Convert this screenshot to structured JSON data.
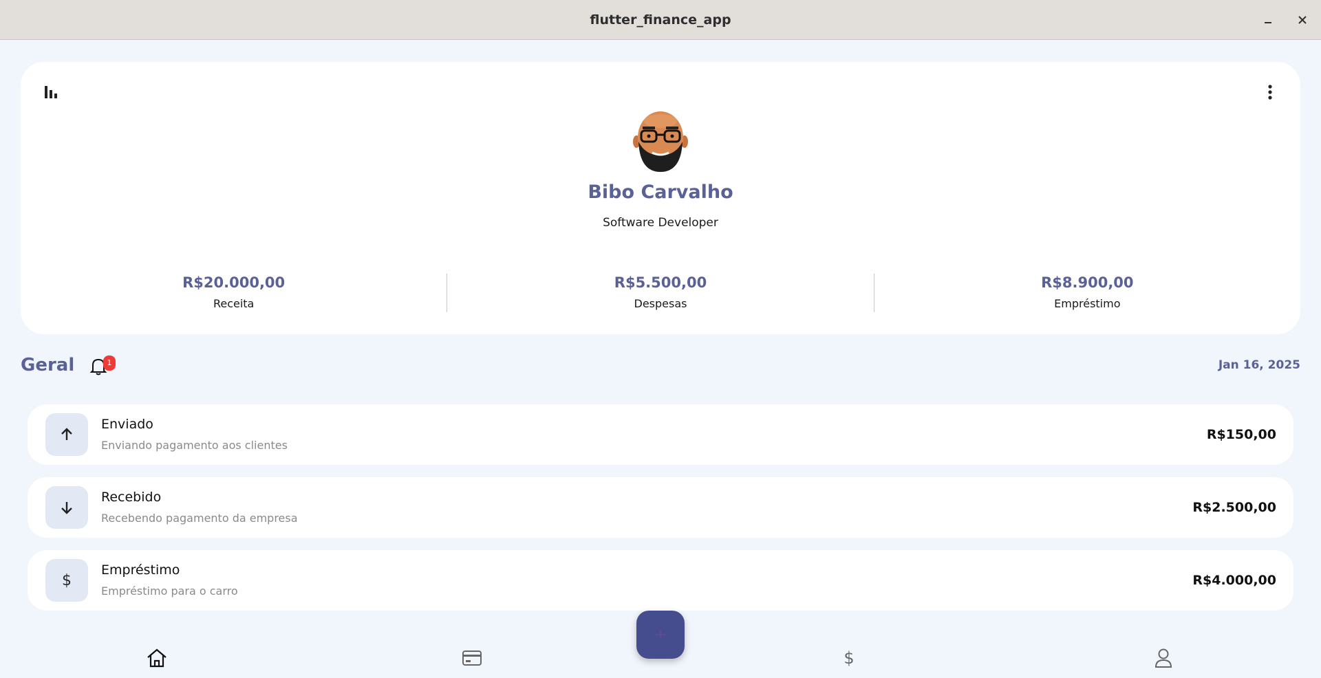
{
  "window": {
    "title": "flutter_finance_app"
  },
  "profile": {
    "name": "Bibo Carvalho",
    "role": "Software Developer"
  },
  "stats": [
    {
      "value": "R$20.000,00",
      "label": "Receita"
    },
    {
      "value": "R$5.500,00",
      "label": "Despesas"
    },
    {
      "value": "R$8.900,00",
      "label": "Empréstimo"
    }
  ],
  "section": {
    "title": "Geral",
    "date": "Jan 16, 2025",
    "notification_count": "1"
  },
  "transactions": [
    {
      "icon": "arrow-up-icon",
      "title": "Enviado",
      "description": "Enviando pagamento aos clientes",
      "amount": "R$150,00"
    },
    {
      "icon": "arrow-down-icon",
      "title": "Recebido",
      "description": "Recebendo pagamento da empresa",
      "amount": "R$2.500,00"
    },
    {
      "icon": "dollar-icon",
      "title": "Empréstimo",
      "description": "Empréstimo para o carro",
      "amount": "R$4.000,00"
    }
  ],
  "nav": {
    "items": [
      "home-icon",
      "card-icon",
      "dollar-icon",
      "person-icon"
    ],
    "fab_icon": "plus-icon"
  },
  "colors": {
    "accent": "#5a6196",
    "fab": "#464d8e",
    "background": "#f1f6fc",
    "badge": "#ef3b37",
    "icon_tile": "#e3e8f5"
  }
}
